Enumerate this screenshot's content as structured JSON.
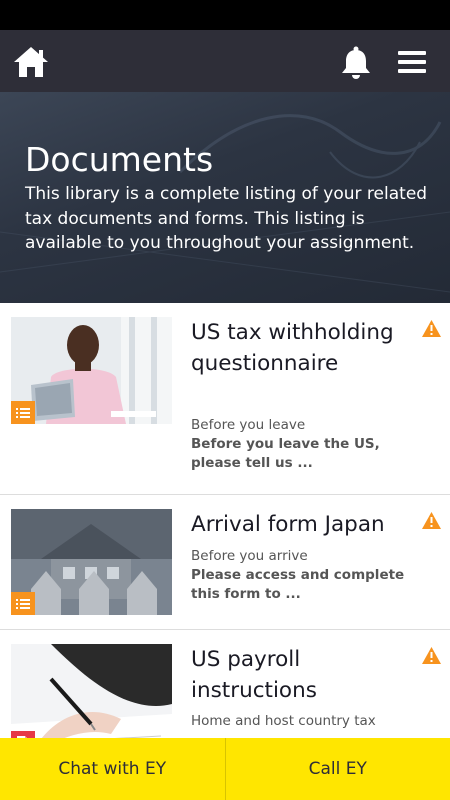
{
  "colors": {
    "header_bg": "#2e2e38",
    "accent_yellow": "#ffe600",
    "warning_orange": "#f7931e",
    "badge_orange": "#f7931e",
    "badge_red": "#e63946"
  },
  "header": {
    "home_icon": "home-icon",
    "bell_icon": "bell-icon",
    "menu_icon": "hamburger-menu-icon"
  },
  "hero": {
    "title": "Documents",
    "description": "This library is a complete listing of your related tax documents and forms. This listing is available to you throughout your assignment."
  },
  "documents": [
    {
      "title": "US tax withholding questionnaire",
      "timing": "Before you leave",
      "description": "Before you leave the US, please tell us ...",
      "type_icon": "list-icon",
      "status_icon": "warning-icon"
    },
    {
      "title": "Arrival form Japan",
      "timing": "Before you arrive",
      "description": "Please access and complete this form to ...",
      "type_icon": "list-icon",
      "status_icon": "warning-icon"
    },
    {
      "title": "US payroll instructions",
      "timing": "Home and host country tax",
      "description": "",
      "type_icon": "pdf-icon",
      "status_icon": "warning-icon"
    }
  ],
  "footer": {
    "chat_label": "Chat with EY",
    "call_label": "Call EY"
  }
}
